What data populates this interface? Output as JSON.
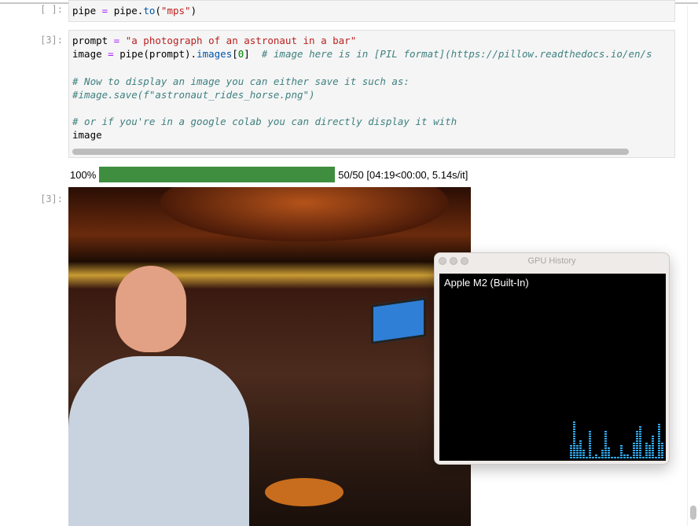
{
  "cells": [
    {
      "prompt": "[ ]:",
      "code_parts": [
        "pipe",
        " = ",
        "pipe.",
        "to",
        "(",
        "\"mps\"",
        ")"
      ]
    },
    {
      "prompt": "[3]:",
      "line1": [
        "prompt",
        " = ",
        "\"a photograph of an astronaut in a bar\""
      ],
      "line2": [
        "image",
        " = ",
        "pipe(prompt).",
        "images",
        "[",
        "0",
        "]  ",
        "# image here is in [PIL format](https://pillow.readthedocs.io/en/s"
      ],
      "line4": "# Now to display an image you can either save it such as:",
      "line5": "#image.save(f\"astronaut_rides_horse.png\")",
      "line7": "# or if you're in a google colab you can directly display it with",
      "line8": "image"
    }
  ],
  "progress": {
    "percent_label": "100%",
    "fraction": 1.0,
    "status": "50/50 [04:19<00:00, 5.14s/it]",
    "color": "#3f8e3f"
  },
  "output_prompt": "[3]:",
  "gpu_window": {
    "title": "GPU History",
    "device": "Apple M2 (Built-In)",
    "bar_color": "#2fa8f0",
    "history": [
      6,
      16,
      6,
      8,
      4,
      1,
      12,
      1,
      2,
      1,
      4,
      12,
      5,
      1,
      1,
      1,
      6,
      2,
      2,
      1,
      7,
      12,
      14,
      1,
      7,
      6,
      10,
      1,
      15,
      7
    ]
  }
}
